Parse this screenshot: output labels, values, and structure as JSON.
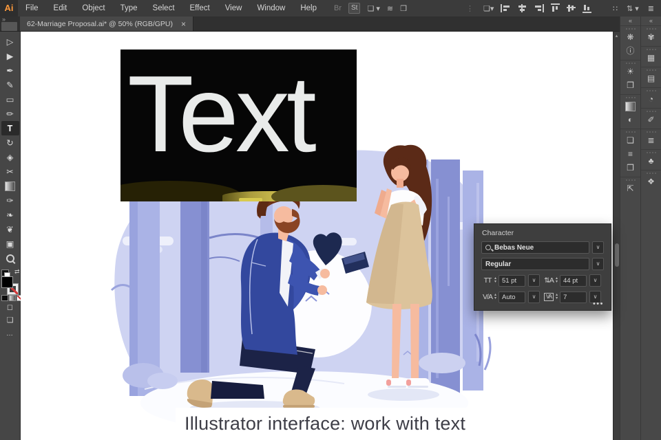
{
  "app": {
    "logo": "Ai",
    "accent_orange": "#ff9a3c"
  },
  "menubar": {
    "menus": [
      "File",
      "Edit",
      "Object",
      "Type",
      "Select",
      "Effect",
      "View",
      "Window",
      "Help"
    ],
    "quick_icons": [
      {
        "name": "bridge-icon",
        "glyph": "Br",
        "cls": "dim"
      },
      {
        "name": "adobe-stock-icon",
        "glyph": "St",
        "cls": "boxed"
      },
      {
        "name": "workspace-switcher-icon",
        "glyph": "❏ ▾"
      },
      {
        "name": "feather-icon",
        "glyph": "≋"
      },
      {
        "name": "touch-type-icon",
        "glyph": "❒"
      }
    ],
    "divider_icon": "⋮",
    "align_icons": [
      {
        "name": "document-setup-icon",
        "glyph": "❏▾"
      },
      {
        "name": "align-left-icon",
        "css": "h-l"
      },
      {
        "name": "align-center-icon",
        "css": "h-c"
      },
      {
        "name": "align-right-icon",
        "css": "h-r"
      },
      {
        "name": "align-top-icon",
        "css": "v-t"
      },
      {
        "name": "align-middle-icon",
        "css": "v-m"
      },
      {
        "name": "align-bottom-icon",
        "css": "v-b"
      }
    ],
    "far_icons": [
      {
        "name": "snap-grid-icon",
        "glyph": "∷"
      },
      {
        "name": "arrange-documents-icon",
        "glyph": "⇅ ▾"
      },
      {
        "name": "document-list-icon",
        "glyph": "≣"
      }
    ]
  },
  "tabbar": {
    "expand_icon": "»"
  },
  "document_tab": {
    "title": "62-Marriage Proposal.ai* @ 50% (RGB/GPU)",
    "close_icon": "×"
  },
  "toolbar": {
    "tools": [
      {
        "name": "selection-tool",
        "glyph": "▷"
      },
      {
        "name": "direct-selection-tool",
        "glyph": "▶"
      },
      {
        "name": "pen-tool",
        "glyph": "✒"
      },
      {
        "name": "curvature-tool",
        "glyph": "✎"
      },
      {
        "name": "rectangle-tool",
        "glyph": "▭"
      },
      {
        "name": "paintbrush-tool",
        "glyph": "✏"
      },
      {
        "name": "type-tool",
        "glyph": "T",
        "active": true
      },
      {
        "name": "rotate-tool",
        "glyph": "↻"
      },
      {
        "name": "eraser-tool",
        "glyph": "◈"
      },
      {
        "name": "scissors-tool",
        "glyph": "✂"
      },
      {
        "name": "gradient-tool",
        "css": "gradient"
      },
      {
        "name": "eyedropper-tool",
        "glyph": "✑"
      },
      {
        "name": "hand-tool",
        "glyph": "❧"
      },
      {
        "name": "symbol-sprayer-tool",
        "glyph": "❦"
      },
      {
        "name": "artboard-tool",
        "glyph": "▣"
      },
      {
        "name": "zoom-tool",
        "css": "zoom"
      }
    ],
    "swap_icon": "⇄",
    "fill_color": "#000000",
    "draw_mode_icon": "◻",
    "screen_mode_icon": "❏",
    "more_icon": "…"
  },
  "scrollbar": {
    "up_icon": "▴"
  },
  "dock": {
    "collapse_icon": "«",
    "col1_groups": [
      [
        {
          "name": "properties-panel-icon",
          "glyph": "❋"
        },
        {
          "name": "info-panel-icon",
          "glyph": "ⓘ"
        }
      ],
      [
        {
          "name": "appearance-panel-icon",
          "glyph": "☀"
        },
        {
          "name": "graphic-styles-panel-icon",
          "glyph": "❐"
        }
      ],
      [
        {
          "name": "gradient-panel-icon",
          "css": "grad"
        },
        {
          "name": "transparency-panel-icon",
          "glyph": "◐"
        }
      ],
      [
        {
          "name": "transform-panel-icon",
          "glyph": "❏"
        },
        {
          "name": "align-panel-icon",
          "glyph": "≡"
        },
        {
          "name": "pathfinder-panel-icon",
          "glyph": "❒"
        }
      ],
      [
        {
          "name": "export-panel-icon",
          "glyph": "⇱"
        }
      ]
    ],
    "col2_groups": [
      [
        {
          "name": "color-panel-icon",
          "glyph": "✾"
        }
      ],
      [
        {
          "name": "color-guide-panel-icon",
          "glyph": "▦"
        }
      ],
      [
        {
          "name": "swatches-panel-icon",
          "glyph": "▤"
        }
      ],
      [
        {
          "name": "gradient-library-panel-icon",
          "glyph": "◔"
        }
      ],
      [
        {
          "name": "brushes-panel-icon",
          "glyph": "✐"
        }
      ],
      [
        {
          "name": "stroke-panel-icon",
          "glyph": "≣"
        }
      ],
      [
        {
          "name": "symbols-panel-icon",
          "glyph": "♣"
        }
      ],
      [
        {
          "name": "layers-panel-icon",
          "glyph": "❖"
        }
      ]
    ]
  },
  "character_panel": {
    "title": "Character",
    "font_family": "Bebas Neue",
    "font_style": "Regular",
    "size_icon": "TT",
    "font_size": "51 pt",
    "leading_icon": "⇅A",
    "leading": "44 pt",
    "kerning_icon": "V/A",
    "kerning": "Auto",
    "tracking_icon": "VA",
    "tracking": "7",
    "chevron_icon": "∨",
    "step_up_icon": "▴",
    "step_down_icon": "▾",
    "more_icon": "•••"
  },
  "artboard": {
    "overlay_text": "Text",
    "caption": "Illustrator interface: work with text"
  },
  "colors": {
    "ui_dark": "#303030",
    "ui_mid": "#464646",
    "panel": "#3e3e3e",
    "canvas": "#ffffff",
    "blob": "#ced3f2",
    "tree_light": "#aab3e6",
    "tree_mid": "#8690d2",
    "moon": "#fdfdff",
    "skin": "#f6bb9f",
    "hair_brown": "#6b3118",
    "beard": "#8a4424",
    "jacket_blue": "#33489e",
    "pants_navy": "#1c2347",
    "dress_beige": "#dcc39b",
    "shoe_beige": "#d9b98c",
    "snow": "#fbfcff",
    "caption_text": "#3e3e47",
    "text_object": "#e9ebea"
  }
}
